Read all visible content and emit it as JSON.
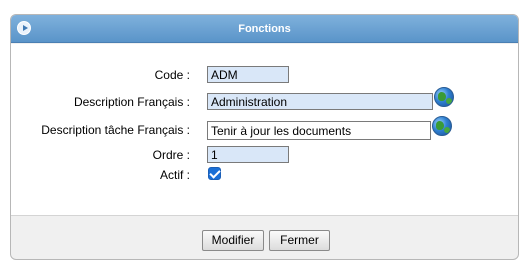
{
  "panel": {
    "title": "Fonctions",
    "collapse_icon": "circle-arrow-right-icon"
  },
  "form": {
    "code": {
      "label": "Code :",
      "value": "ADM"
    },
    "description_fr": {
      "label": "Description Français :",
      "value": "Administration",
      "icon": "globe-icon"
    },
    "description_tache_fr": {
      "label": "Description tâche Français :",
      "value": "Tenir à jour les documents",
      "icon": "globe-icon"
    },
    "ordre": {
      "label": "Ordre :",
      "value": "1"
    },
    "actif": {
      "label": "Actif :",
      "checked": true
    }
  },
  "buttons": {
    "modifier": "Modifier",
    "fermer": "Fermer"
  },
  "colors": {
    "header_gradient_top": "#7fb1dc",
    "header_gradient_bottom": "#5a94c9",
    "input_highlight": "#d9e7f8",
    "checkbox": "#1a6fd6"
  }
}
